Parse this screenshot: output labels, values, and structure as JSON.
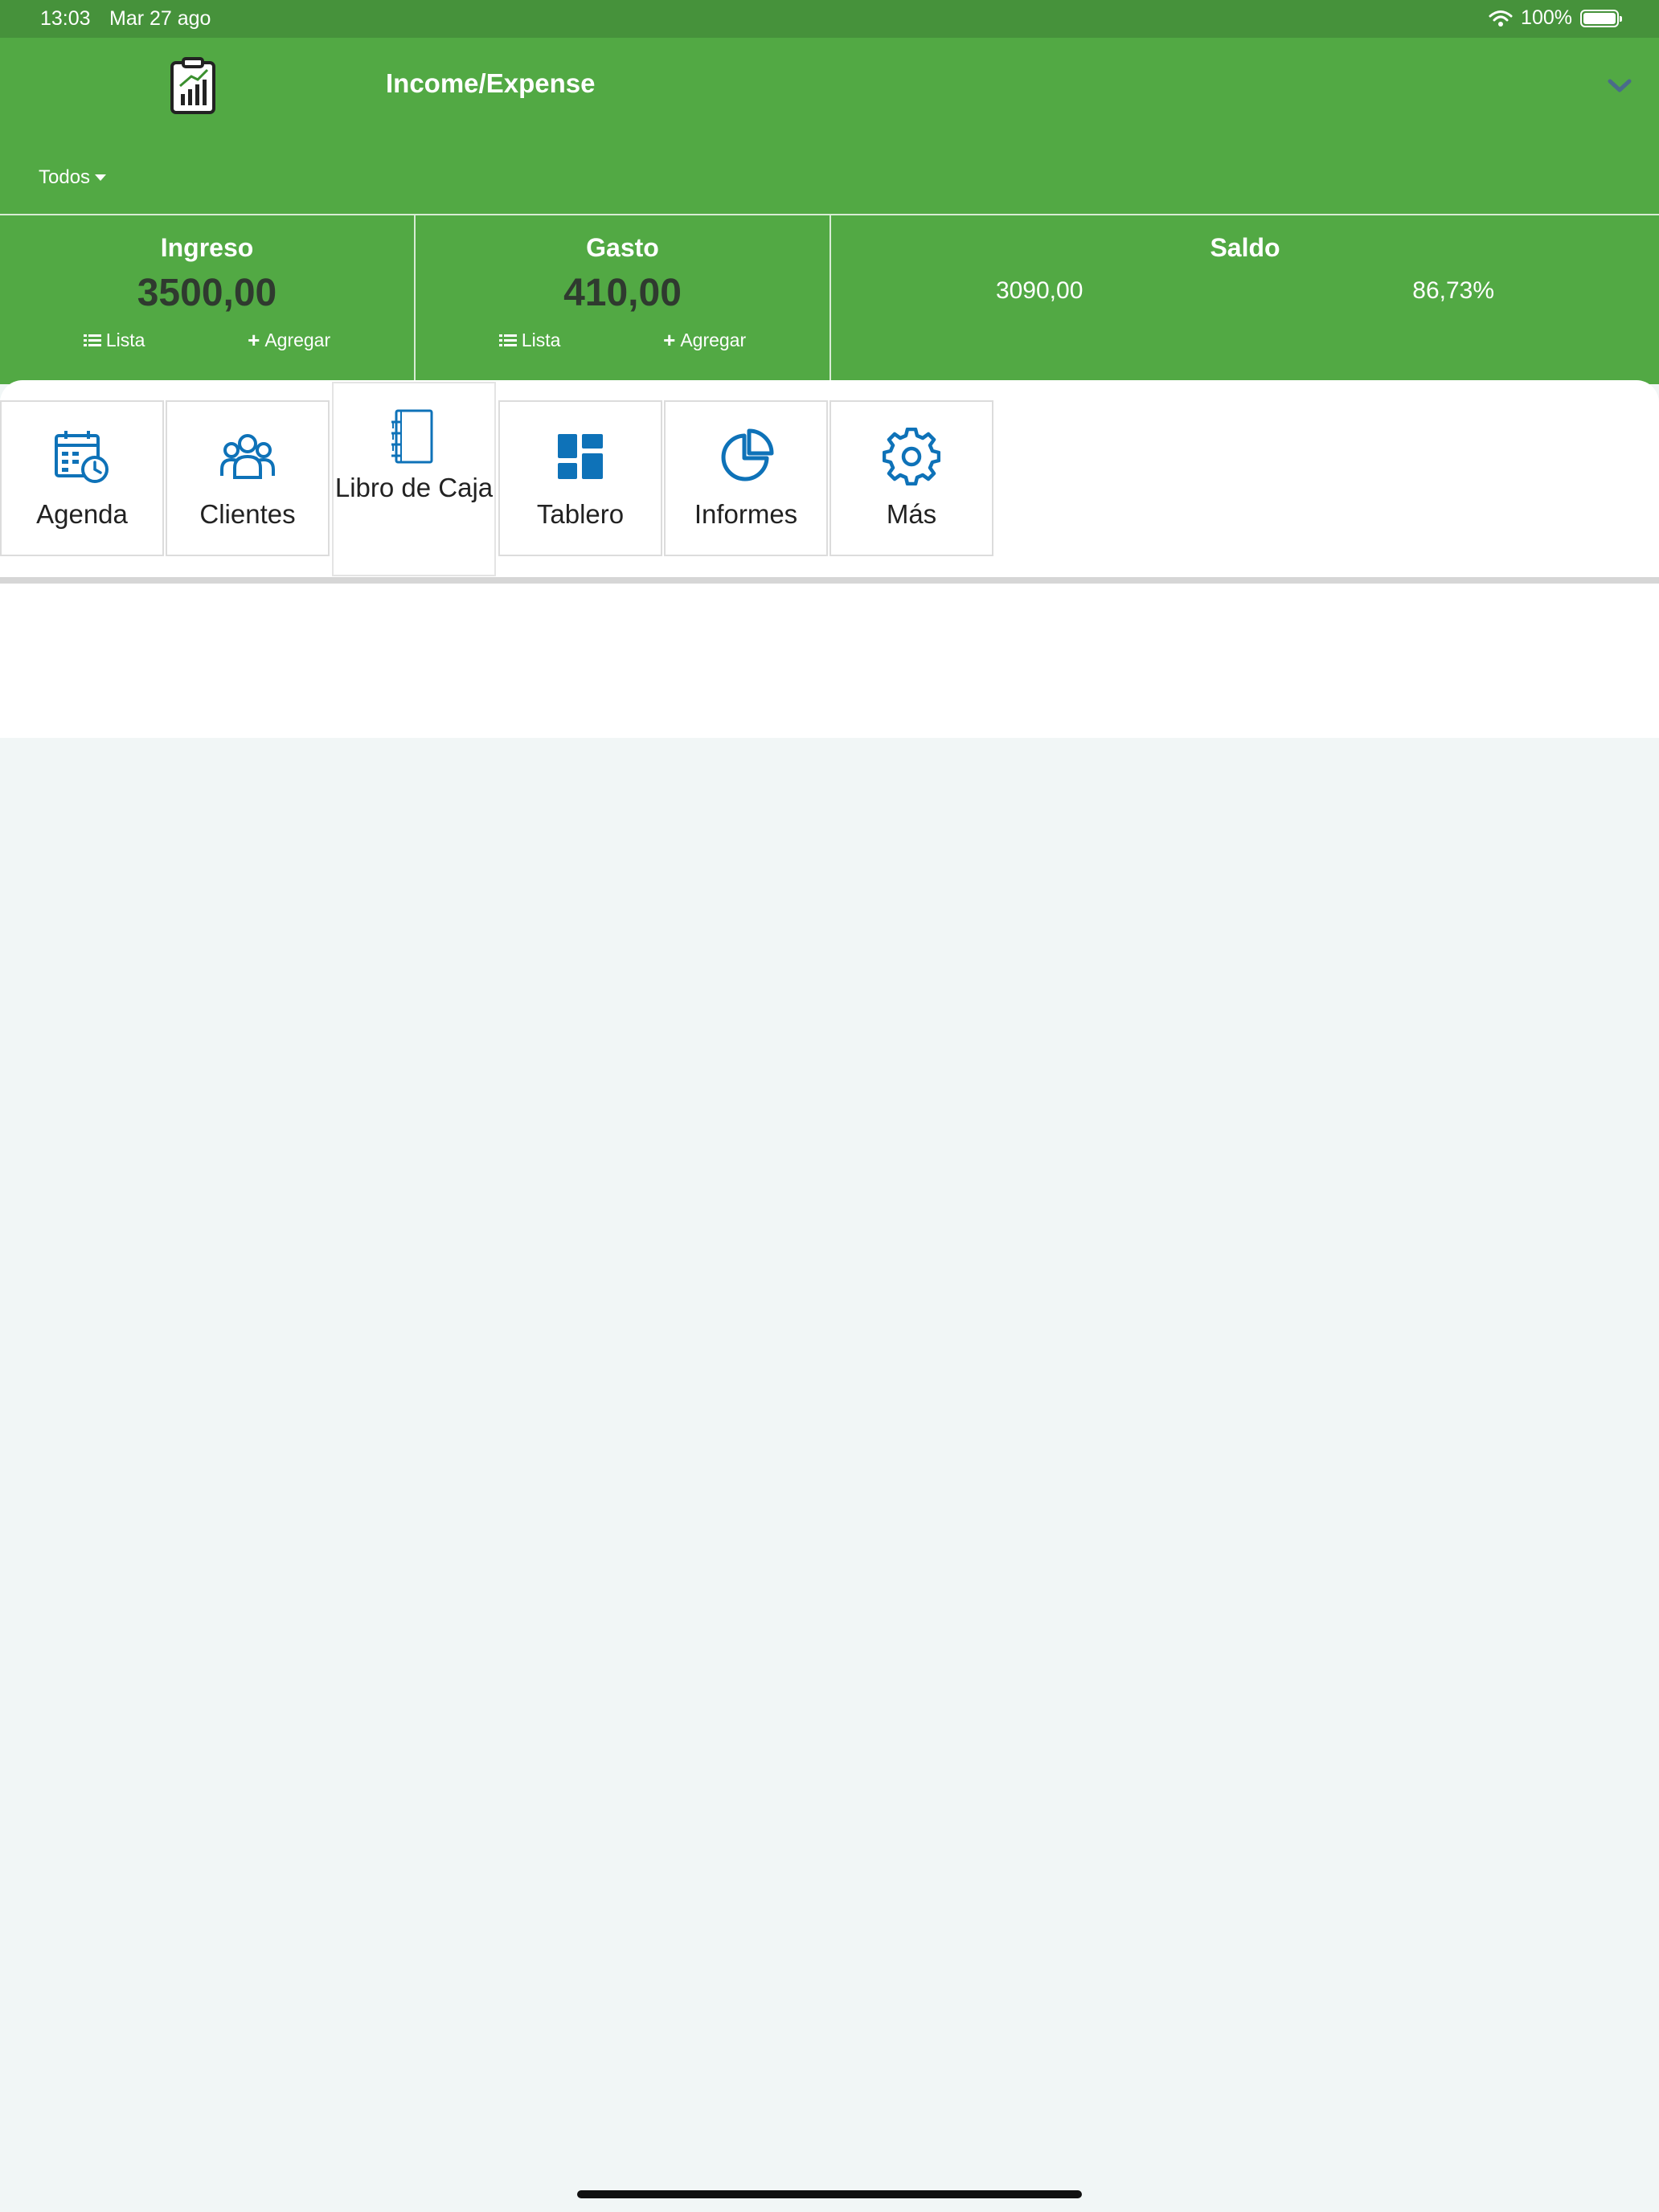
{
  "status_bar": {
    "time": "13:03",
    "date": "Mar 27 ago",
    "battery": "100%"
  },
  "header": {
    "title": "Income/Expense",
    "filter_label": "Todos"
  },
  "summary": {
    "income": {
      "title": "Ingreso",
      "amount": "3500,00",
      "list_label": "Lista",
      "add_label": "Agregar"
    },
    "expense": {
      "title": "Gasto",
      "amount": "410,00",
      "list_label": "Lista",
      "add_label": "Agregar"
    },
    "balance": {
      "title": "Saldo",
      "value": "3090,00",
      "percent": "86,73%"
    }
  },
  "menu": [
    {
      "label": "Agenda",
      "icon": "calendar-clock-icon"
    },
    {
      "label": "Clientes",
      "icon": "users-icon"
    },
    {
      "label": "Libro de Caja",
      "icon": "notebook-icon",
      "active": true
    },
    {
      "label": "Tablero",
      "icon": "dashboard-icon"
    },
    {
      "label": "Informes",
      "icon": "pie-chart-icon"
    },
    {
      "label": "Más",
      "icon": "gear-icon"
    }
  ],
  "colors": {
    "green": "#52a944",
    "status_green": "#46923b",
    "icon_blue": "#0e72b8",
    "background": "#f1f6f6"
  }
}
